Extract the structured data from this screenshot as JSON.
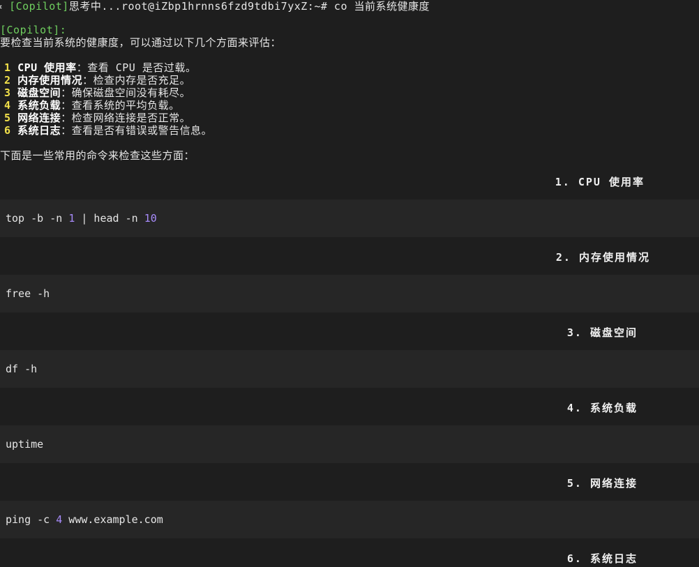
{
  "prompt": {
    "prefix": "✲ ",
    "tag": "[Copilot]",
    "thinking": "思考中...",
    "user_host": "root@iZbp1hrnns6fzd9tdbi7yxZ:~#",
    "command": " co 当前系统健康度"
  },
  "response": {
    "tag": "[Copilot]:",
    "intro": "要检查当前系统的健康度，可以通过以下几个方面来评估：",
    "items": [
      {
        "n": "1",
        "title": "CPU 使用率",
        "desc": "：查看 CPU 是否过载。"
      },
      {
        "n": "2",
        "title": "内存使用情况",
        "desc": "：检查内存是否充足。"
      },
      {
        "n": "3",
        "title": "磁盘空间",
        "desc": "：确保磁盘空间没有耗尽。"
      },
      {
        "n": "4",
        "title": "系统负载",
        "desc": "：查看系统的平均负载。"
      },
      {
        "n": "5",
        "title": "网络连接",
        "desc": "：检查网络连接是否正常。"
      },
      {
        "n": "6",
        "title": "系统日志",
        "desc": "：查看是否有错误或警告信息。"
      }
    ],
    "commands_intro": "下面是一些常用的命令来检查这些方面："
  },
  "sections": [
    {
      "heading": "1. CPU 使用率",
      "code": [
        [
          "top -b -n ",
          "t"
        ],
        [
          "1",
          "n"
        ],
        [
          " | head -n ",
          "t"
        ],
        [
          "10",
          "n"
        ]
      ]
    },
    {
      "heading": "2. 内存使用情况",
      "code": [
        [
          "free -h",
          "t"
        ]
      ]
    },
    {
      "heading": "3. 磁盘空间",
      "code": [
        [
          "df -h",
          "t"
        ]
      ]
    },
    {
      "heading": "4. 系统负载",
      "code": [
        [
          "uptime",
          "t"
        ]
      ]
    },
    {
      "heading": "5. 网络连接",
      "code": [
        [
          "ping -c ",
          "t"
        ],
        [
          "4",
          "n"
        ],
        [
          " www.example.com",
          "t"
        ]
      ]
    },
    {
      "heading": "6. 系统日志",
      "code": []
    }
  ],
  "colors": {
    "background": "#1e1e1e",
    "code_band": "#262626",
    "tag_green": "#6fcf5f",
    "number_yellow": "#f2e14a",
    "code_number": "#a78bfa"
  }
}
